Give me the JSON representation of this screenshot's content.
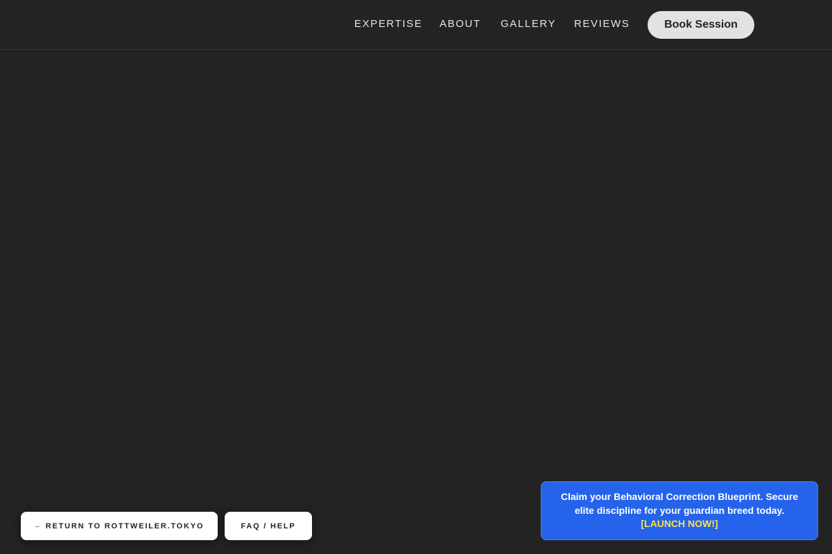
{
  "header": {
    "nav": [
      {
        "label": "EXPERTISE"
      },
      {
        "label": "ABOUT"
      },
      {
        "label": "GALLERY"
      },
      {
        "label": "REVIEWS"
      }
    ],
    "book_label": "Book Session"
  },
  "footer_buttons": {
    "return_label": "RETURN TO ROTTWEILER.TOKYO",
    "return_icon": "arrow-left-icon",
    "faq_label": "FAQ / HELP"
  },
  "promo": {
    "message": "Claim your Behavioral Correction Blueprint. Secure elite discipline for your guardian breed today.",
    "cta": "[LAUNCH NOW!]"
  },
  "colors": {
    "background": "#232323",
    "promo_bg": "#2563eb",
    "promo_cta": "#fde047",
    "book_button": "#e2e2e2"
  }
}
